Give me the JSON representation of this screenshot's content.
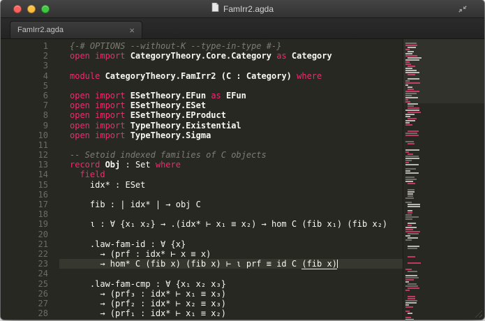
{
  "window": {
    "title": "FamIrr2.agda"
  },
  "tabbar": {
    "tabs": [
      {
        "label": "FamIrr2.agda",
        "close_glyph": "×",
        "active": true
      }
    ]
  },
  "colors": {
    "background": "#272822",
    "keyword": "#f92672",
    "text": "#f8f8f2",
    "comment": "#7d7d74",
    "line_highlight": "#36372e",
    "gutter_foreground": "#6b6d65"
  },
  "editor": {
    "language": "agda",
    "current_line": 23,
    "lines": [
      {
        "n": 1,
        "seg": [
          {
            "t": "{-# OPTIONS --without-K --type-in-type #-}",
            "c": "comment"
          }
        ]
      },
      {
        "n": 2,
        "seg": [
          {
            "t": "open import ",
            "c": "kw"
          },
          {
            "t": "CategoryTheory.Core.Category",
            "c": "bold"
          },
          {
            "t": " ",
            "c": "plain"
          },
          {
            "t": "as",
            "c": "kw"
          },
          {
            "t": " ",
            "c": "plain"
          },
          {
            "t": "Category",
            "c": "bold"
          }
        ]
      },
      {
        "n": 3,
        "seg": []
      },
      {
        "n": 4,
        "seg": [
          {
            "t": "module ",
            "c": "kw"
          },
          {
            "t": "CategoryTheory.FamIrr2 (C : Category)",
            "c": "bold"
          },
          {
            "t": " ",
            "c": "plain"
          },
          {
            "t": "where",
            "c": "kw"
          }
        ]
      },
      {
        "n": 5,
        "seg": []
      },
      {
        "n": 6,
        "seg": [
          {
            "t": "open import ",
            "c": "kw"
          },
          {
            "t": "ESetTheory.EFun",
            "c": "bold"
          },
          {
            "t": " ",
            "c": "plain"
          },
          {
            "t": "as",
            "c": "kw"
          },
          {
            "t": " ",
            "c": "plain"
          },
          {
            "t": "EFun",
            "c": "bold"
          }
        ]
      },
      {
        "n": 7,
        "seg": [
          {
            "t": "open import ",
            "c": "kw"
          },
          {
            "t": "ESetTheory.ESet",
            "c": "bold"
          }
        ]
      },
      {
        "n": 8,
        "seg": [
          {
            "t": "open import ",
            "c": "kw"
          },
          {
            "t": "ESetTheory.EProduct",
            "c": "bold"
          }
        ]
      },
      {
        "n": 9,
        "seg": [
          {
            "t": "open import ",
            "c": "kw"
          },
          {
            "t": "TypeTheory.Existential",
            "c": "bold"
          }
        ]
      },
      {
        "n": 10,
        "seg": [
          {
            "t": "open import ",
            "c": "kw"
          },
          {
            "t": "TypeTheory.Sigma",
            "c": "bold"
          }
        ]
      },
      {
        "n": 11,
        "seg": []
      },
      {
        "n": 12,
        "seg": [
          {
            "t": "-- Setoid indexed families of C objects",
            "c": "comment"
          }
        ]
      },
      {
        "n": 13,
        "seg": [
          {
            "t": "record ",
            "c": "kw"
          },
          {
            "t": "Obj",
            "c": "bold"
          },
          {
            "t": " : Set ",
            "c": "plain"
          },
          {
            "t": "where",
            "c": "kw"
          }
        ]
      },
      {
        "n": 14,
        "seg": [
          {
            "t": "  ",
            "c": "plain"
          },
          {
            "t": "field",
            "c": "kw"
          }
        ]
      },
      {
        "n": 15,
        "seg": [
          {
            "t": "    idx* : ESet",
            "c": "plain"
          }
        ]
      },
      {
        "n": 16,
        "seg": []
      },
      {
        "n": 17,
        "seg": [
          {
            "t": "    fib : | idx* | → obj C",
            "c": "plain"
          }
        ]
      },
      {
        "n": 18,
        "seg": []
      },
      {
        "n": 19,
        "seg": [
          {
            "t": "    ι : ∀ {x₁ x₂} → .(idx* ⊢ x₁ ≡ x₂) → hom C (fib x₁) (fib x₂)",
            "c": "plain"
          }
        ]
      },
      {
        "n": 20,
        "seg": []
      },
      {
        "n": 21,
        "seg": [
          {
            "t": "    .law-fam-id : ∀ {x}",
            "c": "plain"
          }
        ]
      },
      {
        "n": 22,
        "seg": [
          {
            "t": "      → (prf : idx* ⊢ x ≡ x)",
            "c": "plain"
          }
        ]
      },
      {
        "n": 23,
        "seg": [
          {
            "t": "      → hom* C (fib x) (fib x) ⊢ ι prf ≡ id C ",
            "c": "plain"
          },
          {
            "t": "(fib x)",
            "c": "plain",
            "u": true
          },
          {
            "t": "",
            "c": "caret"
          }
        ]
      },
      {
        "n": 24,
        "seg": []
      },
      {
        "n": 25,
        "seg": [
          {
            "t": "    .law-fam-cmp : ∀ {x₁ x₂ x₃}",
            "c": "plain"
          }
        ]
      },
      {
        "n": 26,
        "seg": [
          {
            "t": "      → (prf₃ : idx* ⊢ x₁ ≡ x₃)",
            "c": "plain"
          }
        ]
      },
      {
        "n": 27,
        "seg": [
          {
            "t": "      → (prf₂ : idx* ⊢ x₂ ≡ x₃)",
            "c": "plain"
          }
        ]
      },
      {
        "n": 28,
        "seg": [
          {
            "t": "      → (prf₁ : idx* ⊢ x₁ ≡ x₂)",
            "c": "plain"
          }
        ]
      }
    ]
  },
  "minimap": {
    "rows": 133,
    "palette": {
      "text": "#b9b9b2",
      "keyword": "#c2385f",
      "comment": "#6e6e66"
    }
  }
}
